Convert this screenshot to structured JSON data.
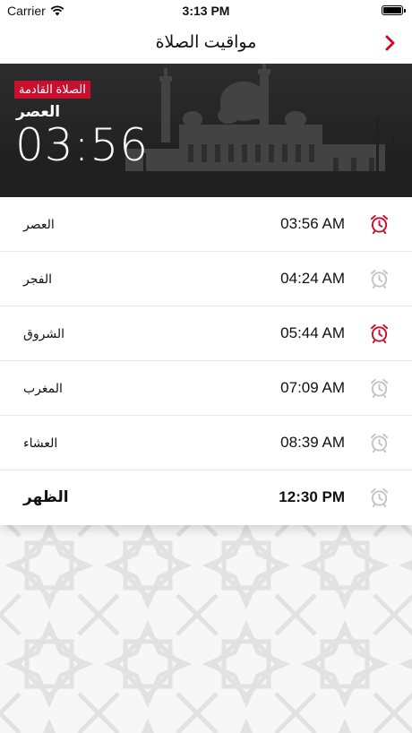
{
  "status_bar": {
    "carrier": "Carrier",
    "time": "3:13 PM",
    "battery_level": 1.0
  },
  "nav": {
    "title": "مواقيت الصلاة",
    "chevron": "chevron-right-icon",
    "accent": "#c8102e"
  },
  "hero": {
    "badge": "الصلاة القادمة",
    "prayer": "العصر",
    "countdown": "03:56"
  },
  "prayers": [
    {
      "name": "العصر",
      "time": "03:56 AM",
      "alarm_on": true
    },
    {
      "name": "الفجر",
      "time": "04:24 AM",
      "alarm_on": false
    },
    {
      "name": "الشروق",
      "time": "05:44 AM",
      "alarm_on": true
    },
    {
      "name": "المغرب",
      "time": "07:09 AM",
      "alarm_on": false
    },
    {
      "name": "العشاء",
      "time": "08:39 AM",
      "alarm_on": false
    },
    {
      "name": "الظهر",
      "time": "12:30 PM",
      "alarm_on": false
    }
  ],
  "colors": {
    "accent": "#c8102e",
    "alarm_off": "#c4c4c4"
  }
}
